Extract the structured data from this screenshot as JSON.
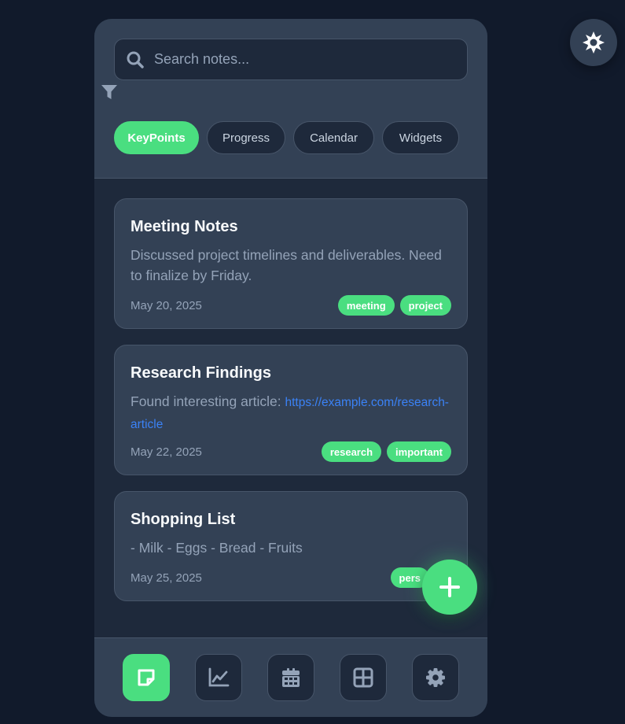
{
  "search": {
    "placeholder": "Search notes...",
    "value": ""
  },
  "tabs": [
    {
      "label": "KeyPoints",
      "active": true
    },
    {
      "label": "Progress",
      "active": false
    },
    {
      "label": "Calendar",
      "active": false
    },
    {
      "label": "Widgets",
      "active": false
    }
  ],
  "notes": [
    {
      "title": "Meeting Notes",
      "body": "Discussed project timelines and deliverables. Need to finalize by Friday.",
      "date": "May 20, 2025",
      "tags": [
        "meeting",
        "project"
      ]
    },
    {
      "title": "Research Findings",
      "body_prefix": "Found interesting article: ",
      "link": "https://example.com/research-article",
      "date": "May 22, 2025",
      "tags": [
        "research",
        "important"
      ]
    },
    {
      "title": "Shopping List",
      "body": "- Milk - Eggs - Bread - Fruits",
      "date": "May 25, 2025",
      "tags": [
        "pers"
      ]
    }
  ],
  "icons": {
    "search": "search-icon",
    "filter": "filter-icon",
    "theme": "sun-icon",
    "add": "plus-icon",
    "nav": [
      "note-icon",
      "chart-icon",
      "calendar-icon",
      "grid-icon",
      "gear-icon"
    ]
  },
  "colors": {
    "background": "#111a2b",
    "panel": "#1e293b",
    "surface": "#334155",
    "accent": "#4ade80",
    "link": "#3b82f6",
    "muted": "#94a3b8"
  }
}
